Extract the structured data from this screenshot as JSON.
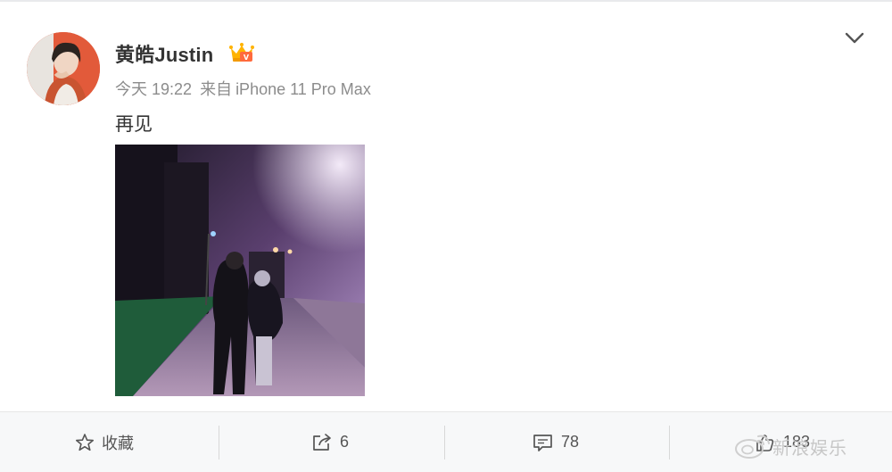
{
  "post": {
    "author": "黄皓Justin",
    "time": "今天 19:22",
    "source_prefix": "来自",
    "device": "iPhone 11 Pro Max",
    "text": "再见"
  },
  "actions": {
    "favorite_label": "收藏",
    "repost_count": "6",
    "comment_count": "78",
    "like_count": "183"
  },
  "watermark": "新浪娱乐",
  "icons": [
    "chevron-down-icon",
    "vip-crown-icon",
    "star-icon",
    "share-icon",
    "comment-icon",
    "like-icon",
    "weibo-logo"
  ],
  "colors": {
    "accent": "#ff8200",
    "meta_text": "#8c8c8c",
    "action_bg": "#f7f8f9"
  }
}
